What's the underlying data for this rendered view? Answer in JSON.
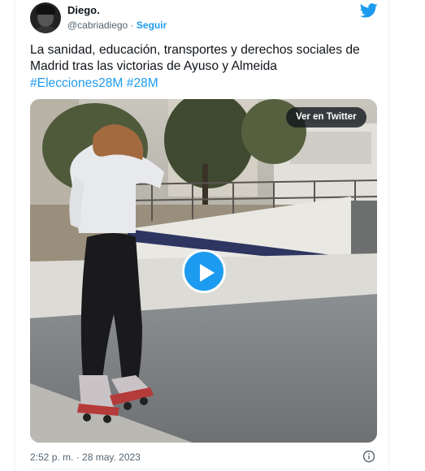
{
  "author": {
    "name": "Diego.",
    "handle": "@cabriadiego",
    "separator": "·",
    "follow_label": "Seguir"
  },
  "tweet": {
    "text": "La sanidad, educación, transportes y derechos sociales de Madrid tras las victorias de Ayuso y Almeida",
    "hashtags": [
      "#Elecciones28M",
      "#28M"
    ]
  },
  "media": {
    "view_label": "Ver en Twitter"
  },
  "footer": {
    "timestamp": "2:52 p. m. · 28 may. 2023"
  },
  "icons": {
    "logo": "twitter-bird-icon",
    "play": "play-icon",
    "info": "info-icon"
  },
  "colors": {
    "accent": "#1d9bf0",
    "text": "#0f1419",
    "muted": "#536471"
  }
}
